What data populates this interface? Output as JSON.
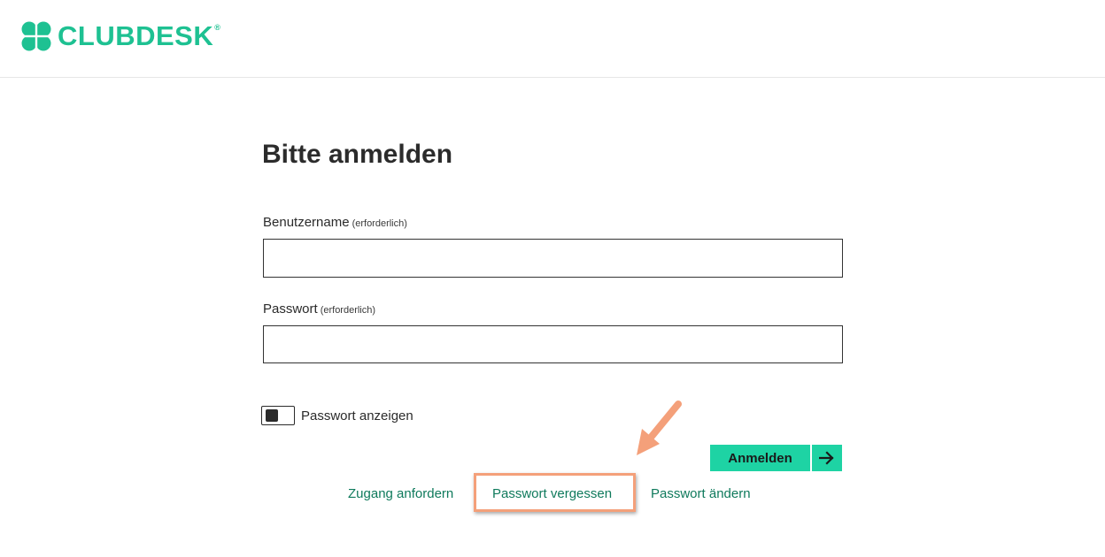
{
  "header": {
    "logo_text": "CLUBDESK",
    "logo_mark": "®",
    "logo_icon": "clover-icon",
    "brand_color": "#1ec192"
  },
  "form": {
    "title": "Bitte anmelden",
    "username": {
      "label": "Benutzername",
      "required_text": "(erforderlich)",
      "value": ""
    },
    "password": {
      "label": "Passwort",
      "required_text": "(erforderlich)",
      "value": ""
    },
    "show_password": {
      "label": "Passwort anzeigen",
      "checked": false
    },
    "submit": {
      "label": "Anmelden",
      "icon": "arrow-right-icon",
      "color": "#1ed3a4"
    }
  },
  "links": {
    "request_access": "Zugang anfordern",
    "forgot_password": "Passwort vergessen",
    "change_password": "Passwort ändern",
    "link_color": "#0f7a5c"
  },
  "annotation": {
    "highlight_color": "#f4a07a"
  }
}
